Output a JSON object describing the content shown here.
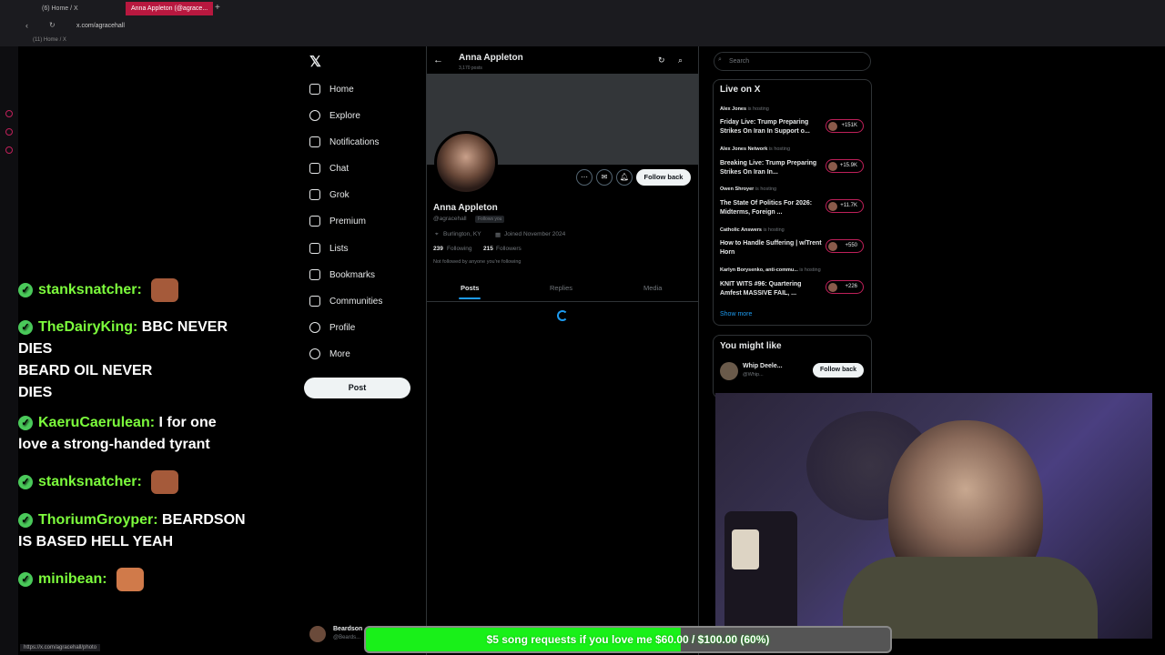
{
  "browser": {
    "tabs": [
      {
        "label": "(6) Home / X"
      },
      {
        "label": "Anna Appleton (@agrace..."
      }
    ],
    "address": "x.com/agracehall",
    "bookmark": "(11) Home / X",
    "status_url": "https://x.com/agracehall/photo"
  },
  "chat": [
    {
      "name": "stanksnatcher:",
      "message": ""
    },
    {
      "name": "TheDairyKing:",
      "message": "BBC NEVER DIES",
      "message2": "BEARD OIL NEVER",
      "message3": "DIES"
    },
    {
      "name": "KaeruCaerulean:",
      "message": "I for one",
      "message2": "love a strong-handed tyrant"
    },
    {
      "name": "stanksnatcher:",
      "message": ""
    },
    {
      "name": "ThoriumGroyper:",
      "message": "BEARDSON",
      "message2": "IS BASED HELL YEAH"
    },
    {
      "name": "minibean:",
      "message": ""
    }
  ],
  "nav": {
    "items": [
      "Home",
      "Explore",
      "Notifications",
      "Chat",
      "Grok",
      "Premium",
      "Lists",
      "Bookmarks",
      "Communities",
      "Profile",
      "More"
    ],
    "post": "Post",
    "account_name": "Beardson",
    "account_handle": "@Beards..."
  },
  "profile": {
    "header_name": "Anna Appleton",
    "header_posts": "3,170 posts",
    "name": "Anna Appleton",
    "handle": "@agracehall",
    "follows_you": "Follows you",
    "location": "Burlington, KY",
    "joined": "Joined November 2024",
    "following_count": "239",
    "following_label": "Following",
    "followers_count": "215",
    "followers_label": "Followers",
    "not_followed": "Not followed by anyone you're following",
    "follow_back": "Follow back",
    "tabs": [
      "Posts",
      "Replies",
      "Media"
    ]
  },
  "right": {
    "search_placeholder": "Search",
    "live_title": "Live on X",
    "live": [
      {
        "host": "Alex Jones",
        "status": "is hosting",
        "title": "Friday Live: Trump Preparing Strikes On Iran In Support o...",
        "count": "+151K"
      },
      {
        "host": "Alex Jones Network",
        "status": "is hosting",
        "title": "Breaking Live: Trump Preparing Strikes On Iran In...",
        "count": "+15.9K"
      },
      {
        "host": "Owen Shroyer",
        "status": "is hosting",
        "title": "The State Of Politics For 2026: Midterms, Foreign ...",
        "count": "+11.7K"
      },
      {
        "host": "Catholic Answers",
        "status": "is hosting",
        "title": "How to Handle Suffering | w/Trent Horn",
        "count": "+550"
      },
      {
        "host": "Karlyn Borysenko, anti-commu...",
        "status": "is hosting",
        "title": "KNIT WITS #96: Quartering Amfest MASSIVE FAIL, ...",
        "count": "+226"
      }
    ],
    "show_more": "Show more",
    "you_might_like": "You might like",
    "suggestion_name": "Whip Deele...",
    "suggestion_handle": "@Whip...",
    "suggestion_button": "Follow back"
  },
  "goal": {
    "text": "$5 song requests if you love me $60.00 / $100.00 (60%)",
    "progress": 0.6
  },
  "colors": {
    "accent": "#1d9bf0",
    "goal_fill": "#19f019",
    "chat_name": "#7cfc3c"
  }
}
